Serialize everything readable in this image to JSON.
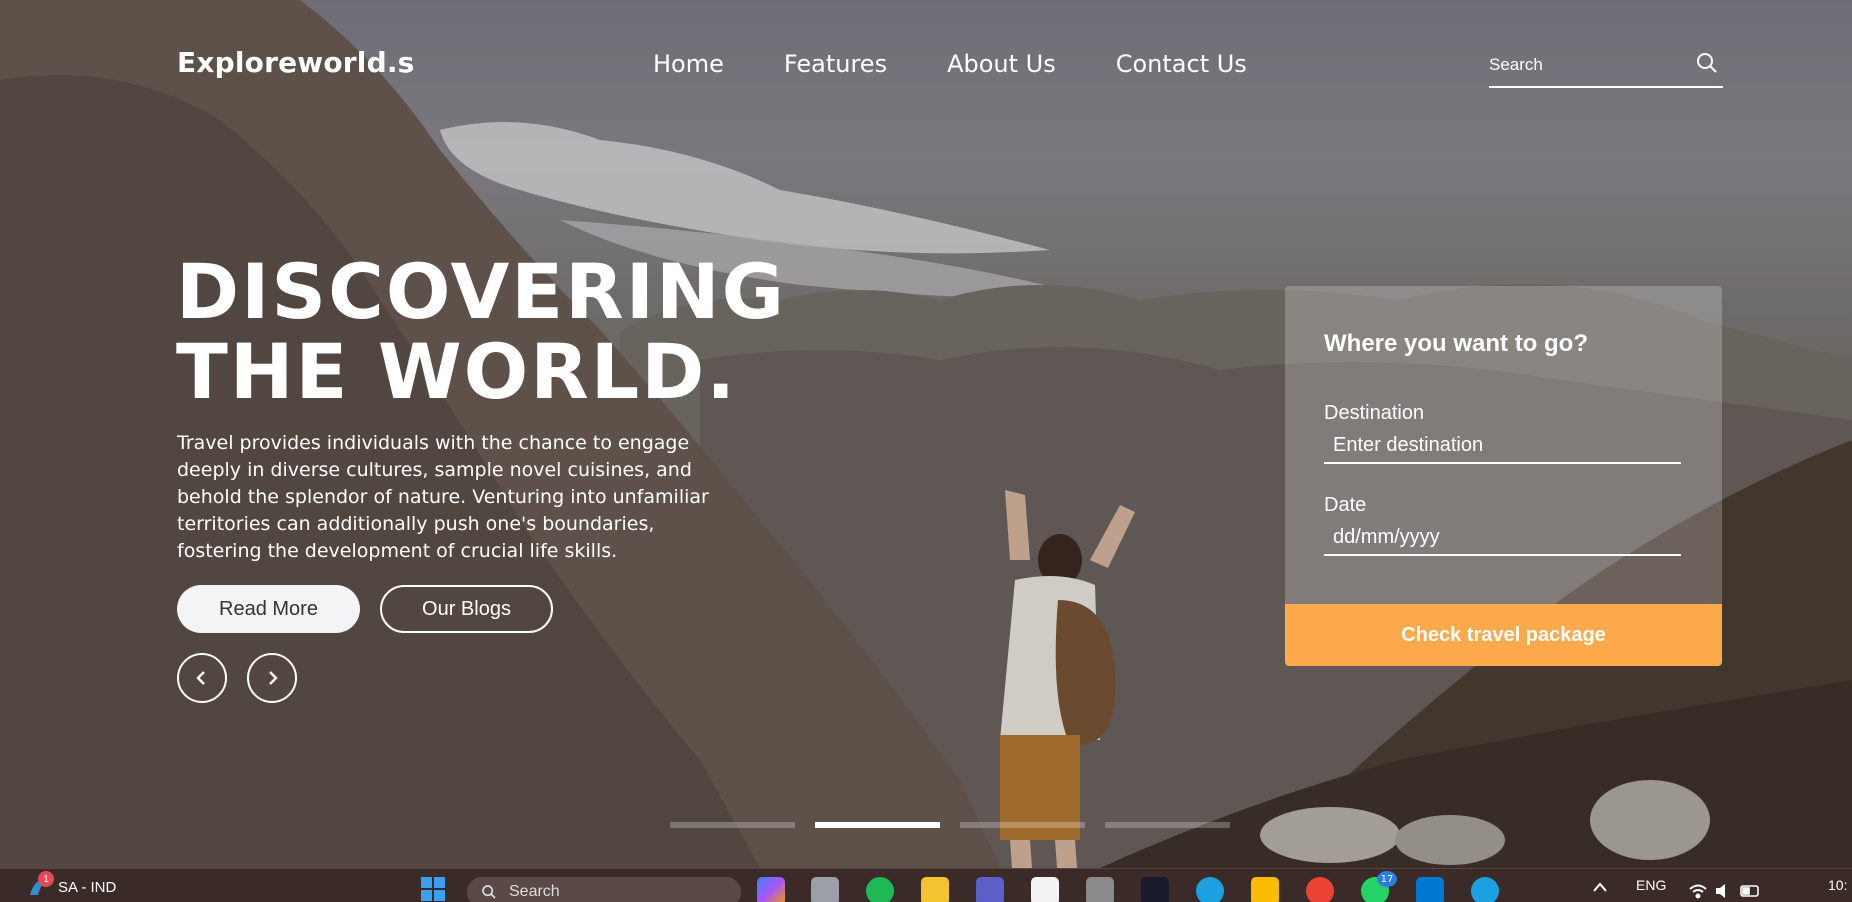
{
  "brand": "Exploreworld.s",
  "nav": {
    "items": [
      "Home",
      "Features",
      "About Us",
      "Contact Us"
    ]
  },
  "search": {
    "placeholder": "Search",
    "icon": "search-icon"
  },
  "hero": {
    "headline_line1": "DISCOVERING",
    "headline_line2": "THE WORLD.",
    "description": "Travel provides individuals with the chance to engage deeply in diverse cultures, sample novel cuisines, and behold the splendor of nature. Venturing into unfamiliar territories can additionally push one's boundaries, fostering the development of crucial life skills.",
    "read_more_label": "Read More",
    "blogs_label": "Our Blogs",
    "prev_icon": "chevron-left-icon",
    "next_icon": "chevron-right-icon"
  },
  "booking": {
    "title": "Where you want to go?",
    "destination_label": "Destination",
    "destination_placeholder": "Enter destination",
    "date_label": "Date",
    "date_placeholder": "dd/mm/yyyy",
    "cta_label": "Check travel package",
    "cta_color": "#ffa94d"
  },
  "slider": {
    "count": 4,
    "active_index": 1
  },
  "taskbar": {
    "weather_text": "SA - IND",
    "weather_badge": "1",
    "search_label": "Search",
    "whatsapp_badge": "17",
    "language": "ENG",
    "clock": "10:"
  }
}
